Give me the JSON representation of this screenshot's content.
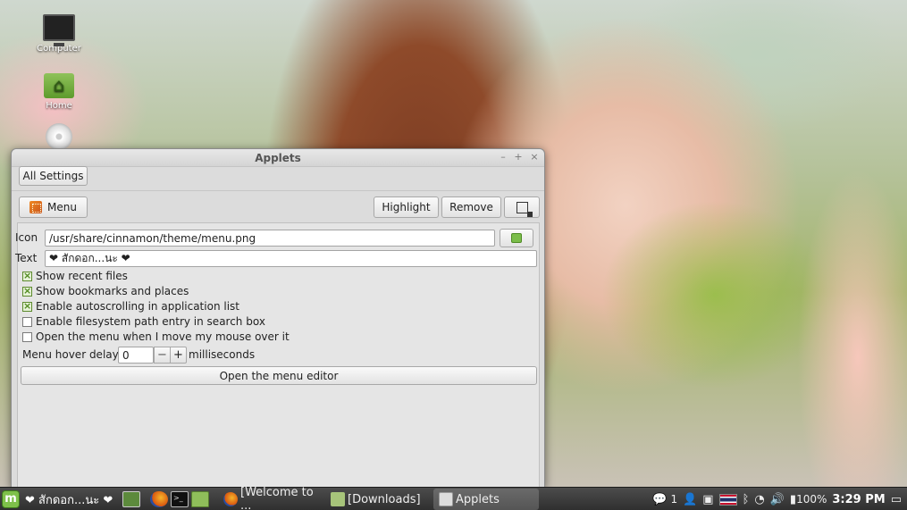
{
  "desktop": {
    "icons": [
      {
        "label": "Computer"
      },
      {
        "label": "Home"
      },
      {
        "label": ""
      }
    ]
  },
  "window": {
    "title": "Applets",
    "controls": {
      "minimize": "–",
      "maximize": "+",
      "close": "×"
    },
    "all_settings_label": "All Settings",
    "applet_button_label": "Menu",
    "highlight_label": "Highlight",
    "remove_label": "Remove",
    "config_icon": "configure-icon"
  },
  "settings": {
    "icon_label": "Icon",
    "icon_value": "/usr/share/cinnamon/theme/menu.png",
    "text_label": "Text",
    "text_value": "❤ สักดอก...นะ ❤",
    "checkboxes": [
      {
        "label": "Show recent files",
        "checked": true
      },
      {
        "label": "Show bookmarks and places",
        "checked": true
      },
      {
        "label": "Enable autoscrolling in application list",
        "checked": true
      },
      {
        "label": "Enable filesystem path entry in search box",
        "checked": false
      },
      {
        "label": "Open the menu when I move my mouse over it",
        "checked": false
      }
    ],
    "hover_delay_label": "Menu hover delay:",
    "hover_delay_value": "0",
    "decrement_label": "−",
    "increment_label": "+",
    "hover_delay_unit": "milliseconds",
    "menu_editor_label": "Open the menu editor"
  },
  "taskbar": {
    "menu_label": "❤ สักดอก...นะ ❤",
    "tasks": [
      {
        "label": "[Welcome to ..."
      },
      {
        "label": "[Downloads]"
      },
      {
        "label": "Applets"
      }
    ],
    "tray": {
      "notifications": "1",
      "battery": "100%",
      "clock": "3:29 PM"
    }
  },
  "colors": {
    "window_bg": "#dcdcdc",
    "taskbar_bg": "#3a3a3a",
    "check_accent": "#4f8a1e"
  }
}
